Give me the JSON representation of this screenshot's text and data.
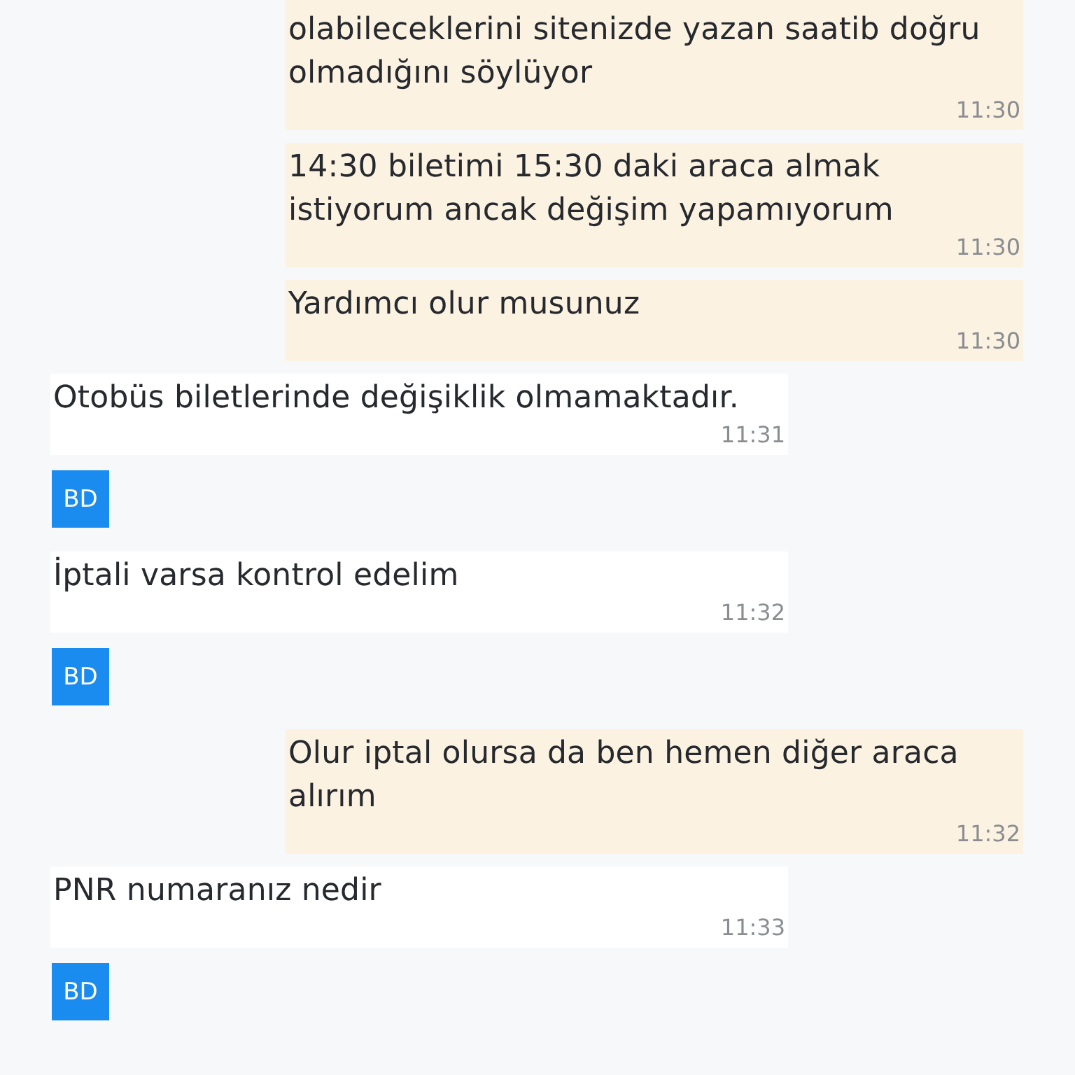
{
  "messages": [
    {
      "kind": "outgoing",
      "text": "olabileceklerini sitenizde yazan saatib doğru olmadığını söylüyor",
      "time": "11:30"
    },
    {
      "kind": "outgoing",
      "text": "14:30 biletimi 15:30 daki araca almak istiyorum ancak değişim yapamıyorum",
      "time": "11:30"
    },
    {
      "kind": "outgoing",
      "text": "Yardımcı olur musunuz",
      "time": "11:30"
    },
    {
      "kind": "incoming",
      "text": "Otobüs biletlerinde değişiklik olmamaktadır.",
      "time": "11:31"
    },
    {
      "kind": "avatar",
      "initials": "BD"
    },
    {
      "kind": "incoming",
      "text": "İptali varsa kontrol edelim",
      "time": "11:32"
    },
    {
      "kind": "avatar",
      "initials": "BD"
    },
    {
      "kind": "outgoing",
      "text": "Olur iptal olursa da ben hemen diğer araca alırım",
      "time": "11:32"
    },
    {
      "kind": "incoming",
      "text": "PNR numaranız nedir",
      "time": "11:33"
    },
    {
      "kind": "avatar",
      "initials": "BD"
    }
  ]
}
